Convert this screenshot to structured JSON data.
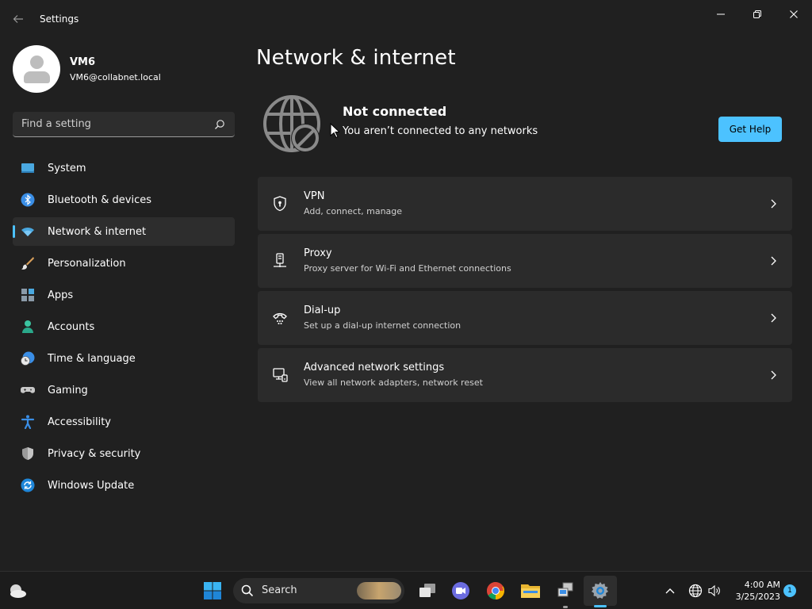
{
  "window": {
    "title": "Settings"
  },
  "profile": {
    "name": "VM6",
    "email": "VM6@collabnet.local"
  },
  "search": {
    "placeholder": "Find a setting"
  },
  "nav": [
    {
      "label": "System",
      "icon": "system-icon"
    },
    {
      "label": "Bluetooth & devices",
      "icon": "bluetooth-icon"
    },
    {
      "label": "Network & internet",
      "icon": "wifi-icon",
      "active": true
    },
    {
      "label": "Personalization",
      "icon": "brush-icon"
    },
    {
      "label": "Apps",
      "icon": "apps-icon"
    },
    {
      "label": "Accounts",
      "icon": "accounts-icon"
    },
    {
      "label": "Time & language",
      "icon": "clock-globe-icon"
    },
    {
      "label": "Gaming",
      "icon": "gamepad-icon"
    },
    {
      "label": "Accessibility",
      "icon": "accessibility-icon"
    },
    {
      "label": "Privacy & security",
      "icon": "shield-icon"
    },
    {
      "label": "Windows Update",
      "icon": "update-icon"
    }
  ],
  "main": {
    "title": "Network & internet",
    "status": {
      "title": "Not connected",
      "subtitle": "You aren’t connected to any networks",
      "help_label": "Get Help"
    },
    "cards": [
      {
        "title": "VPN",
        "subtitle": "Add, connect, manage",
        "icon": "vpn-shield-icon"
      },
      {
        "title": "Proxy",
        "subtitle": "Proxy server for Wi-Fi and Ethernet connections",
        "icon": "proxy-icon"
      },
      {
        "title": "Dial-up",
        "subtitle": "Set up a dial-up internet connection",
        "icon": "dialup-icon"
      },
      {
        "title": "Advanced network settings",
        "subtitle": "View all network adapters, network reset",
        "icon": "network-adapter-icon"
      }
    ]
  },
  "taskbar": {
    "search_label": "Search",
    "time": "4:00 AM",
    "date": "3/25/2023",
    "notification_count": "1"
  },
  "colors": {
    "accent": "#4cc2ff",
    "background": "#202020",
    "card": "#2b2b2b"
  }
}
